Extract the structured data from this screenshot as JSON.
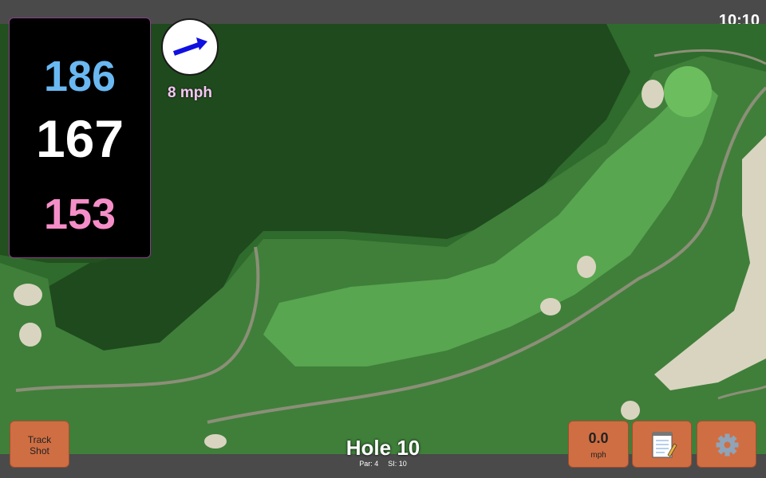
{
  "status": {
    "time": "10:10"
  },
  "distances": {
    "back": "186",
    "middle": "167",
    "front": "153"
  },
  "wind": {
    "speed": "8 mph",
    "icon": "wind-direction-arrow-icon"
  },
  "buttons": {
    "track_shot": "Track\nShot",
    "speed_value": "0.0",
    "speed_unit": "mph",
    "notes_icon": "notepad-icon",
    "settings_icon": "gear-icon"
  },
  "hole": {
    "title": "Hole 10",
    "par": "Par: 4",
    "si": "SI: 10"
  },
  "colors": {
    "button": "#cf6e43",
    "back_distance": "#6ab8f2",
    "front_distance": "#f58ec8",
    "wind_text": "#f6c7f4",
    "bar": "#4a4a4a"
  }
}
